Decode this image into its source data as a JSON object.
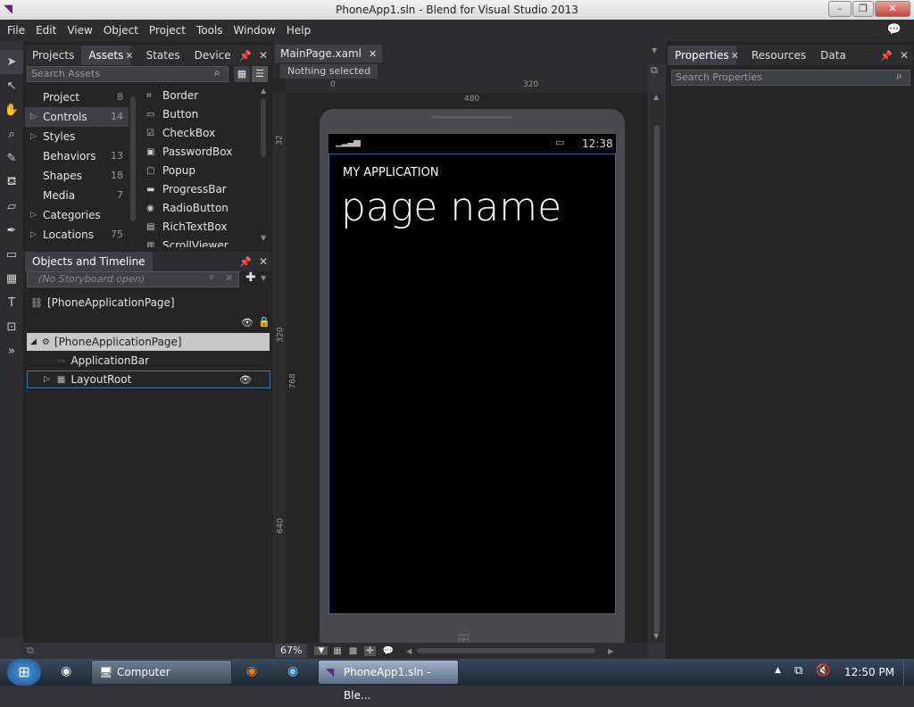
{
  "window": {
    "title": "PhoneApp1.sln - Blend for Visual Studio 2013"
  },
  "menu": [
    "File",
    "Edit",
    "View",
    "Object",
    "Project",
    "Tools",
    "Window",
    "Help"
  ],
  "left_tabs": [
    "Projects",
    "Assets",
    "States",
    "Device"
  ],
  "assets": {
    "search_placeholder": "Search Assets",
    "categories": [
      {
        "label": "Project",
        "count": "8"
      },
      {
        "label": "Controls",
        "count": "14"
      },
      {
        "label": "Styles",
        "count": ""
      },
      {
        "label": "Behaviors",
        "count": "13"
      },
      {
        "label": "Shapes",
        "count": "18"
      },
      {
        "label": "Media",
        "count": "7"
      },
      {
        "label": "Categories",
        "count": ""
      },
      {
        "label": "Locations",
        "count": "75"
      }
    ],
    "controls": [
      "Border",
      "Button",
      "CheckBox",
      "PasswordBox",
      "Popup",
      "ProgressBar",
      "RadioButton",
      "RichTextBox",
      "ScrollViewer"
    ]
  },
  "objects": {
    "title": "Objects and Timeline",
    "storyboard": "(No Storyboard open)",
    "root_label": "[PhoneApplicationPage]",
    "tree": [
      "[PhoneApplicationPage]",
      "ApplicationBar",
      "LayoutRoot"
    ]
  },
  "document": {
    "tab": "MainPage.xaml",
    "status": "Nothing selected",
    "zoom": "67%",
    "ruler_top": [
      "0",
      "480",
      "320"
    ],
    "ruler_left": [
      "32",
      "320",
      "768",
      "640"
    ]
  },
  "phone": {
    "time": "12:38",
    "app_title": "MY APPLICATION",
    "page_title": "page name"
  },
  "right_tabs": [
    "Properties",
    "Resources",
    "Data"
  ],
  "properties": {
    "search_placeholder": "Search Properties"
  },
  "taskbar": {
    "computer": "Computer",
    "blend": "PhoneApp1.sln - Ble...",
    "clock": "12:50 PM"
  }
}
